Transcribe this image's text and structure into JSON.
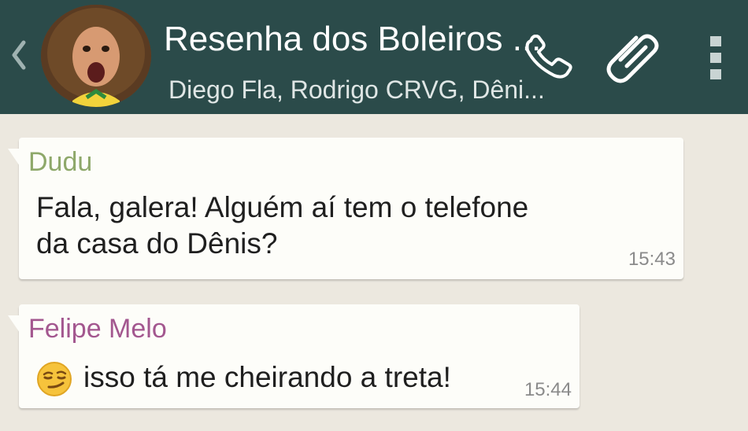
{
  "header": {
    "title": "Resenha dos Boleiros ...",
    "subtitle": "Diego Fla, Rodrigo CRVG, Dêni...",
    "color": "#2b4b4a",
    "icons": [
      "back-chevron-icon",
      "avatar",
      "call-icon",
      "attach-clip-icon",
      "overflow-menu-icon"
    ]
  },
  "messages": [
    {
      "sender": "Dudu",
      "sender_color": "#8ea86a",
      "lines": [
        "Fala, galera! Alguém aí tem o telefone",
        "da casa do Dênis?"
      ],
      "time": "15:43"
    },
    {
      "sender": "Felipe Melo",
      "sender_color": "#a3578f",
      "emoji": "smirk-face",
      "text": "isso tá me cheirando a treta!",
      "time": "15:44"
    }
  ]
}
